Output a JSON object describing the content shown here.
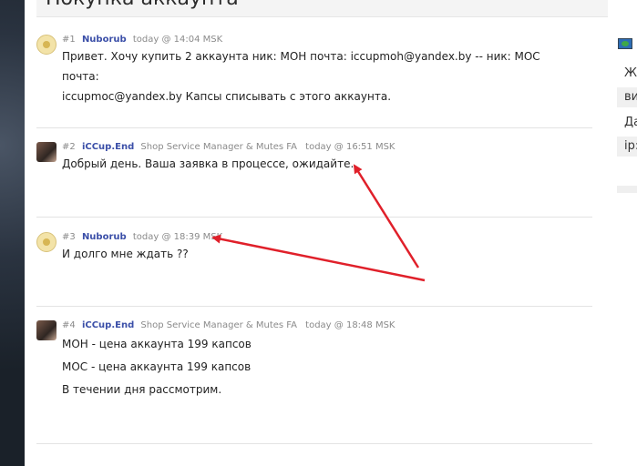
{
  "page_title": "Покупка аккаунта",
  "right_panel": {
    "rows": [
      "Же",
      "ви",
      "Да",
      "ip:"
    ]
  },
  "posts": [
    {
      "num": "#1",
      "author": "Nuborub",
      "role": "",
      "time": "today @ 14:04 MSK",
      "lines": [
        "Привет. Хочу купить 2 аккаунта ник: МОН почта: iccupmoh@yandex.by -- ник: МОС почта:",
        "iccupmoc@yandex.by Капсы списывать с этого аккаунта."
      ]
    },
    {
      "num": "#2",
      "author": "iCCup.End",
      "role": "Shop Service Manager & Mutes FA",
      "time": "today @ 16:51 MSK",
      "lines": [
        "Добрый день. Ваша заявка в процессе, ожидайте."
      ]
    },
    {
      "num": "#3",
      "author": "Nuborub",
      "role": "",
      "time": "today @ 18:39 MSK",
      "lines": [
        "И долго мне ждать ??"
      ]
    },
    {
      "num": "#4",
      "author": "iCCup.End",
      "role": "Shop Service Manager & Mutes FA",
      "time": "today @ 18:48 MSK",
      "lines": [
        "МОН - цена аккаунта 199 капсов",
        "МОС - цена аккаунта 199 капсов",
        "В течении дня рассмотрим."
      ]
    }
  ],
  "colors": {
    "author": "#3b4fa8",
    "arrow": "#e0202a"
  }
}
